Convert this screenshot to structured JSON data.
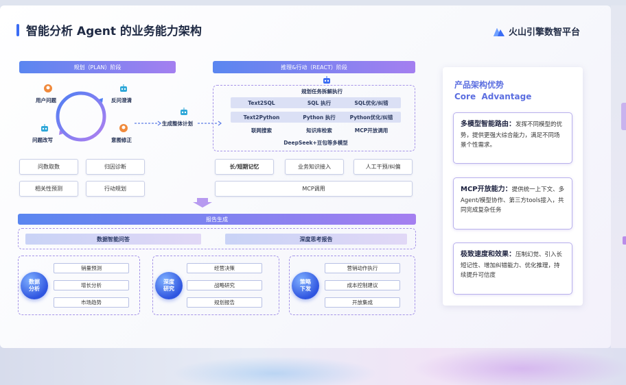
{
  "title": "智能分析 Agent 的业务能力架构",
  "brand": {
    "name": "火山引擎数智平台"
  },
  "plan": {
    "header": "规划（PLAN）阶段",
    "cycle": [
      "用户问题",
      "反问澄清",
      "意图修正",
      "问题改写"
    ],
    "next": "生成整体计划",
    "boxes": [
      "问数取数",
      "归因诊断",
      "相关性预测",
      "行动规划"
    ]
  },
  "react": {
    "header": "推理&行动（REACT）阶段",
    "top": "规划任务拆解执行",
    "row1": [
      "Text2SQL",
      "SQL 执行",
      "SQL优化/纠错"
    ],
    "row2": [
      "Text2Python",
      "Python 执行",
      "Python优化/纠错"
    ],
    "row3": [
      "联网搜索",
      "知识库检索",
      "MCP开放调用"
    ],
    "model": "DeepSeek+豆包等多模型",
    "boxes": [
      "长/短期记忆",
      "业务知识接入",
      "人工干预/纠偏"
    ],
    "mcp": "MCP调用"
  },
  "report": {
    "header": "报告生成",
    "sub": [
      "数据智能问答",
      "深度思考报告"
    ],
    "groups": [
      {
        "badge": "数据分析",
        "items": [
          "销量预测",
          "增长分析",
          "市场趋势"
        ]
      },
      {
        "badge": "深度研究",
        "items": [
          "经营决策",
          "战略研究",
          "规划报告"
        ]
      },
      {
        "badge": "策略下发",
        "items": [
          "营销动作执行",
          "成本控制建议",
          "开放集成"
        ]
      }
    ]
  },
  "advantages": {
    "title_cn": "产品架构优势",
    "title_en": "Core  Advantage",
    "items": [
      {
        "head": "多模型智能路由：",
        "text": "发挥不同模型的优势，提供更强大综合能力，满足不同场景个性需求。"
      },
      {
        "head": "MCP开放能力：",
        "text": "提供统一上下文、多Agent/模型协作、第三方tools接入，共同完成复杂任务"
      },
      {
        "head": "极致速度和效果：",
        "text": "压制幻觉、引入长短记性、增加纠错能力、优化推理，持续提升可信度"
      }
    ]
  },
  "colors": {
    "accent": "#3b6cf4",
    "gradient_start": "#5a86f0",
    "gradient_end": "#a47ff0",
    "panel_title": "#5b6ee0"
  }
}
